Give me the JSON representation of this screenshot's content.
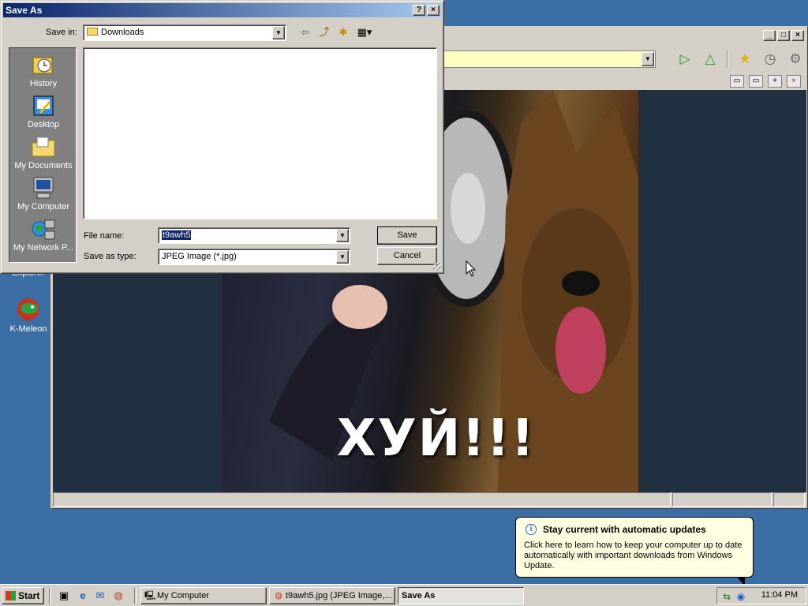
{
  "desktop": {
    "icons": [
      {
        "label": "Explorer",
        "glyph": "e",
        "color": "#2060c0"
      },
      {
        "label": "K-Meleon",
        "glyph": "◍",
        "color": "#c04020"
      }
    ]
  },
  "browser": {
    "title_buttons": {
      "minimize": "_",
      "maximize": "□",
      "close": "×"
    },
    "address_bar": {
      "value": "",
      "dropdown": "▼"
    },
    "nav_icons": [
      {
        "name": "go-icon",
        "glyph": "▷",
        "color": "#20a020"
      },
      {
        "name": "up-icon",
        "glyph": "△",
        "color": "#20a020"
      },
      {
        "name": "favorites-star-icon",
        "glyph": "★",
        "color": "#e0b000"
      },
      {
        "name": "history-clock-icon",
        "glyph": "◷",
        "color": "#606060"
      },
      {
        "name": "settings-gear-icon",
        "glyph": "⚙",
        "color": "#707070"
      }
    ],
    "tool_icons": [
      {
        "name": "minimize-panel-icon",
        "glyph": "▭"
      },
      {
        "name": "restore-panel-icon",
        "glyph": "▭"
      },
      {
        "name": "new-panel-icon",
        "glyph": "+"
      },
      {
        "name": "close-panel-icon",
        "glyph": "×"
      }
    ],
    "image_caption": "ХУЙ!!!"
  },
  "dialog": {
    "title": "Save As",
    "title_buttons": {
      "help": "?",
      "close": "×"
    },
    "save_in_label": "Save in:",
    "save_in_value": "Downloads",
    "dropdown": "▼",
    "tool_icons": [
      {
        "name": "back-arrow-icon",
        "glyph": "⇦"
      },
      {
        "name": "up-folder-icon",
        "glyph": "⤴"
      },
      {
        "name": "new-folder-icon",
        "glyph": "✱"
      },
      {
        "name": "view-menu-icon",
        "glyph": "▦▾"
      }
    ],
    "places": [
      {
        "label": "History",
        "name": "history"
      },
      {
        "label": "Desktop",
        "name": "desktop"
      },
      {
        "label": "My Documents",
        "name": "my-documents"
      },
      {
        "label": "My Computer",
        "name": "my-computer"
      },
      {
        "label": "My Network P...",
        "name": "my-network-places"
      }
    ],
    "file_name_label": "File name:",
    "file_name_value": "t9awh5",
    "save_as_type_label": "Save as type:",
    "save_as_type_value": "JPEG Image (*.jpg)",
    "save_button": "Save",
    "cancel_button": "Cancel"
  },
  "balloon": {
    "info_glyph": "i",
    "title": "Stay current with automatic updates",
    "body": "Click here to learn how to keep your computer up to date automatically with important downloads from Windows Update."
  },
  "taskbar": {
    "start_label": "Start",
    "quick_launch": [
      {
        "name": "show-desktop-icon",
        "glyph": "▣"
      },
      {
        "name": "internet-explorer-icon",
        "glyph": "e"
      },
      {
        "name": "outlook-express-icon",
        "glyph": "✉"
      },
      {
        "name": "k-meleon-icon",
        "glyph": "◍"
      }
    ],
    "tasks": [
      {
        "label": "My Computer",
        "glyph": "🖳",
        "active": false
      },
      {
        "label": "t9awh5.jpg (JPEG Image,...",
        "glyph": "◍",
        "active": false
      },
      {
        "label": "Save As",
        "glyph": "",
        "active": true
      }
    ],
    "tray_icons": [
      {
        "name": "network-icon",
        "glyph": "⇆"
      },
      {
        "name": "windows-update-icon",
        "glyph": "◉"
      }
    ],
    "clock": "11:04 PM"
  }
}
